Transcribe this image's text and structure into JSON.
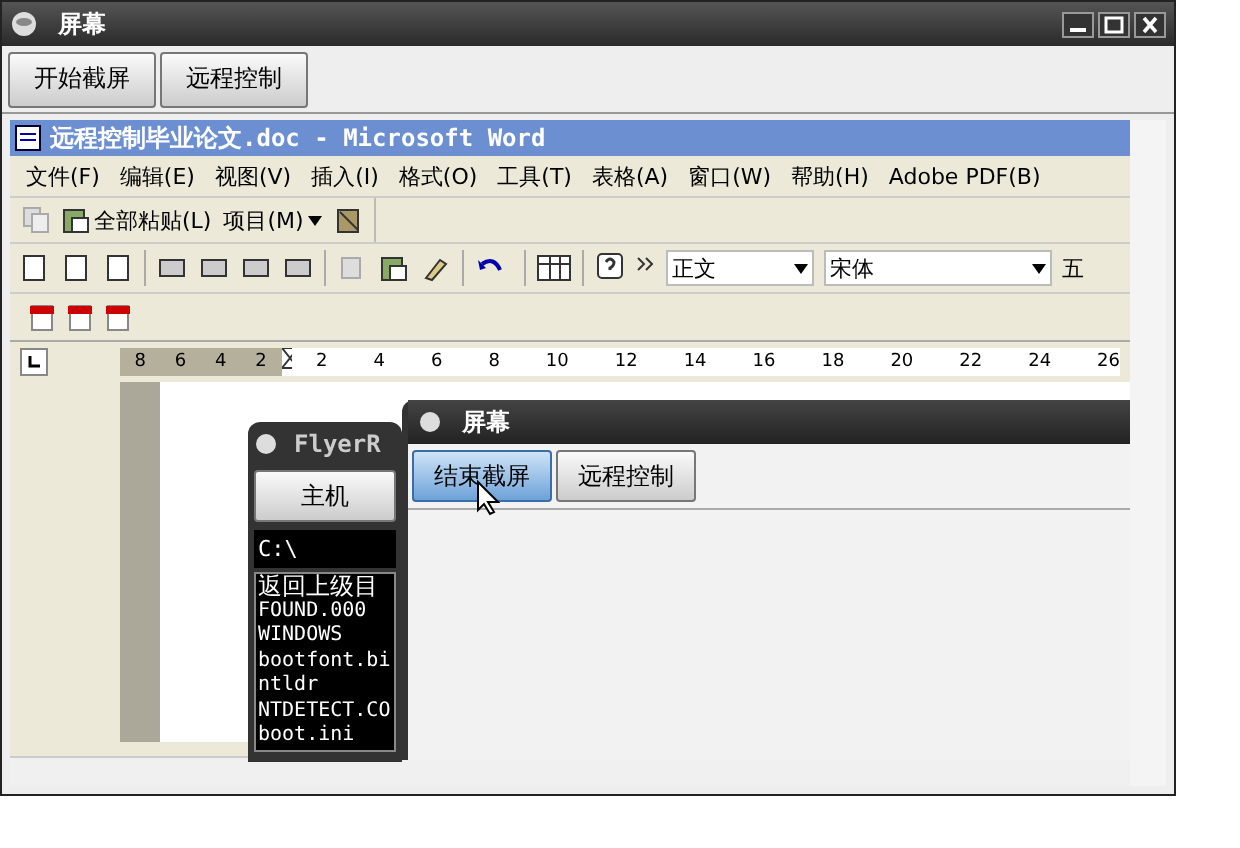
{
  "window": {
    "title": "屏幕"
  },
  "toolbar": {
    "buttons": [
      {
        "label": "开始截屏"
      },
      {
        "label": "远程控制"
      }
    ]
  },
  "screen_view": {
    "word": {
      "title": "远程控制毕业论文.doc - Microsoft Word",
      "menu": [
        "文件(F)",
        "编辑(E)",
        "视图(V)",
        "插入(I)",
        "格式(O)",
        "工具(T)",
        "表格(A)",
        "窗口(W)",
        "帮助(H)",
        "Adobe PDF(B)"
      ],
      "clipboard_bar": [
        "全部粘贴(L)",
        "项目(M)"
      ],
      "formatting": {
        "style": "正文",
        "font": "宋体",
        "size": "五"
      },
      "ruler": {
        "left_labels": [
          "8",
          "6",
          "4",
          "2"
        ],
        "right_labels": [
          "2",
          "4",
          "6",
          "8",
          "10",
          "12",
          "14",
          "16",
          "18",
          "20",
          "22",
          "24",
          "26"
        ]
      }
    },
    "flyer_window": {
      "title": "FlyerR",
      "host_button": "主机",
      "path": "C:\\",
      "files": [
        "返回上级目",
        "FOUND.000",
        "WINDOWS",
        "bootfont.bi",
        "ntldr",
        "NTDETECT.CO",
        "boot.ini"
      ]
    },
    "capture_window": {
      "title": "屏幕",
      "buttons": [
        {
          "label": "结束截屏",
          "pressed": true
        },
        {
          "label": "远程控制",
          "pressed": false
        }
      ]
    }
  }
}
